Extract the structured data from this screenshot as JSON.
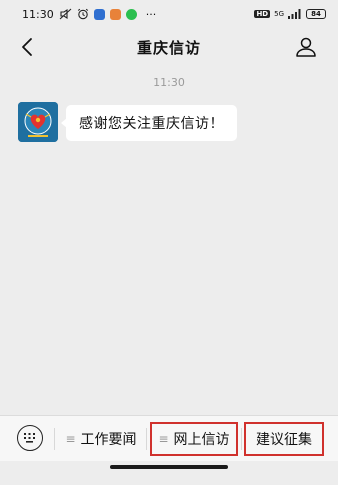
{
  "status_bar": {
    "time": "11:30",
    "more": "···",
    "hd_label": "HD",
    "network_label": "5G",
    "battery": "84",
    "app_colors": [
      "#2f6fd0",
      "#e8823a",
      "#2bbf4f"
    ]
  },
  "nav": {
    "title": "重庆信访"
  },
  "chat": {
    "timestamp": "11:30",
    "message": "感谢您关注重庆信访！"
  },
  "menu": {
    "item1": "工作要闻",
    "item2": "网上信访",
    "item3": "建议征集",
    "highlight_color": "#d0312d"
  }
}
